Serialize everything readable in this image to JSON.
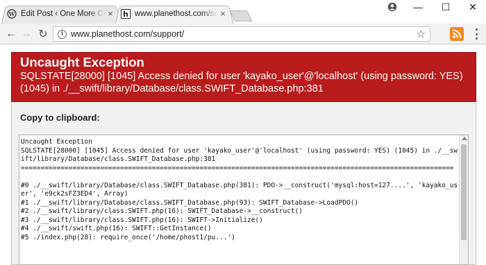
{
  "browser": {
    "tabs": [
      {
        "title": "Edit Post ‹ One More Cup",
        "icon": "wordpress-icon",
        "active": false
      },
      {
        "title": "www.planethost.com/sup",
        "icon": "planethost-favicon",
        "active": true
      }
    ],
    "close_glyph": "×",
    "window_controls": {
      "minimize": "—",
      "maximize": "☐",
      "close": "✕"
    },
    "nav": {
      "back": "←",
      "forward": "→",
      "reload": "↻"
    },
    "address": {
      "url": "www.planethost.com/support/",
      "info_glyph": "i"
    },
    "star_glyph": "☆",
    "rss_color": "#f28a1e",
    "user_icon": "user-account-icon"
  },
  "page": {
    "colors": {
      "header_bg": "#b81c1c",
      "body_bg": "#f1f1f1"
    },
    "error": {
      "title": "Uncaught Exception",
      "message": "SQLSTATE[28000] [1045] Access denied for user 'kayako_user'@'localhost' (using password: YES) (1045) in ./__swift/library/Database/class.SWIFT_Database.php:381"
    },
    "clipboard_label": "Copy to clipboard:",
    "trace_lines": [
      "Uncaught Exception",
      "SQLSTATE[28000] [1045] Access denied for user 'kayako_user'@'localhost' (using password: YES) (1045) in ./__swift/library/Database/class.SWIFT_Database.php:381",
      "=============================================================================================================",
      "",
      "#0 ./__swift/library/Database/class.SWIFT_Database.php(381): PDO->__construct('mysql:host=127....', 'kayako_user', 'e9ck2sFZ3ED4', Array)",
      "#1 ./__swift/library/Database/class.SWIFT_Database.php(93): SWIFT_Database->LoadPDO()",
      "#2 ./__swift/library/class.SWIFT.php(16): SWIFT_Database->__construct()",
      "#3 ./__swift/library/class.SWIFT.php(16): SWIFT->Initialize()",
      "#4 ./__swift/swift.php(16): SWIFT::GetInstance()",
      "#5 ./index.php(28): require_once('/home/phost1/pu...')"
    ]
  }
}
